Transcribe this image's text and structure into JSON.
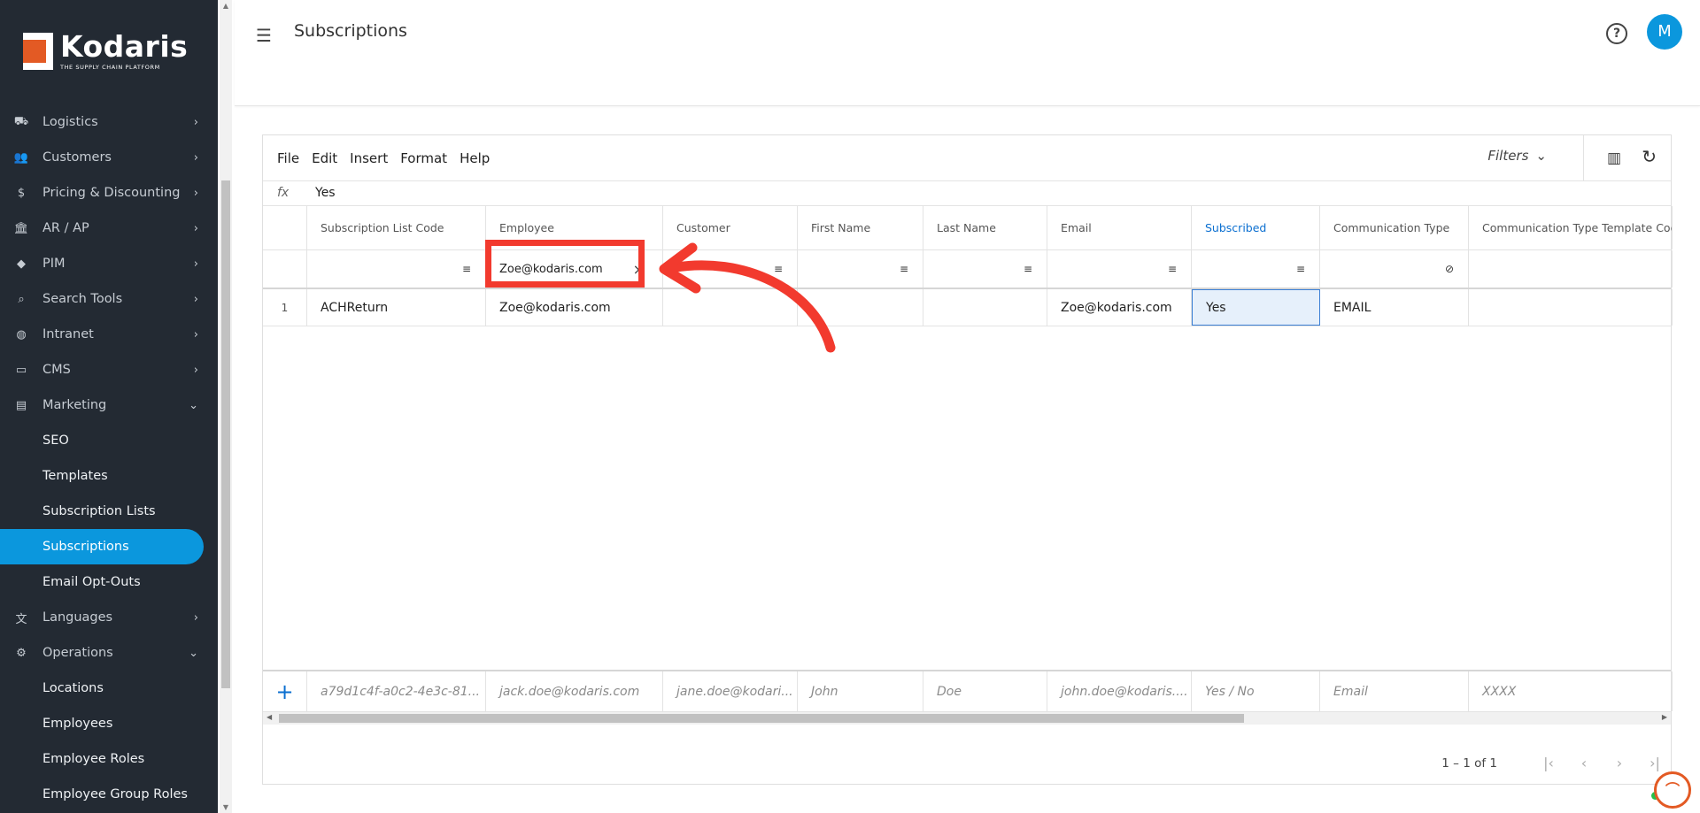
{
  "brand": {
    "name": "Kodaris",
    "tagline": "THE SUPPLY CHAIN PLATFORM"
  },
  "sidebar": {
    "items": [
      {
        "label": "Logistics",
        "icon": "truck-icon"
      },
      {
        "label": "Customers",
        "icon": "people-icon"
      },
      {
        "label": "Pricing & Discounting",
        "icon": "dollar-icon"
      },
      {
        "label": "AR / AP",
        "icon": "bank-icon"
      },
      {
        "label": "PIM",
        "icon": "tag-icon"
      },
      {
        "label": "Search Tools",
        "icon": "search-icon"
      },
      {
        "label": "Intranet",
        "icon": "globe-icon"
      },
      {
        "label": "CMS",
        "icon": "cms-icon"
      },
      {
        "label": "Marketing",
        "icon": "marketing-icon"
      }
    ],
    "marketing_sub": [
      "SEO",
      "Templates",
      "Subscription Lists",
      "Subscriptions",
      "Email Opt-Outs"
    ],
    "after_marketing": [
      {
        "label": "Languages",
        "icon": "translate-icon"
      },
      {
        "label": "Operations",
        "icon": "operations-icon"
      }
    ],
    "operations_sub": [
      "Locations",
      "Employees",
      "Employee Roles",
      "Employee Group Roles"
    ]
  },
  "header": {
    "title": "Subscriptions",
    "avatar_initial": "M"
  },
  "grid": {
    "menu": [
      "File",
      "Edit",
      "Insert",
      "Format",
      "Help"
    ],
    "filters_label": "Filters",
    "fx_label": "fx",
    "fx_value": "Yes",
    "columns": [
      "Subscription List Code",
      "Employee",
      "Customer",
      "First Name",
      "Last Name",
      "Email",
      "Subscribed",
      "Communication Type",
      "Communication Type Template Code"
    ],
    "employee_filter_value": "Zoe@kodaris.com",
    "row": {
      "num": "1",
      "subscription_list_code": "ACHReturn",
      "employee": "Zoe@kodaris.com",
      "customer": "",
      "first_name": "",
      "last_name": "",
      "email": "Zoe@kodaris.com",
      "subscribed": "Yes",
      "communication_type": "EMAIL",
      "template_code": ""
    },
    "new_row_placeholders": [
      "a79d1c4f-a0c2-4e3c-81...",
      "jack.doe@kodaris.com",
      "jane.doe@kodari...",
      "John",
      "Doe",
      "john.doe@kodaris....",
      "Yes / No",
      "Email",
      "XXXX"
    ],
    "pager_range": "1 – 1 of 1"
  },
  "colors": {
    "accent": "#0b97dd",
    "sidebar_bg": "#232a33",
    "annotation_red": "#f23a2e",
    "brand_orange": "#e35a24"
  }
}
